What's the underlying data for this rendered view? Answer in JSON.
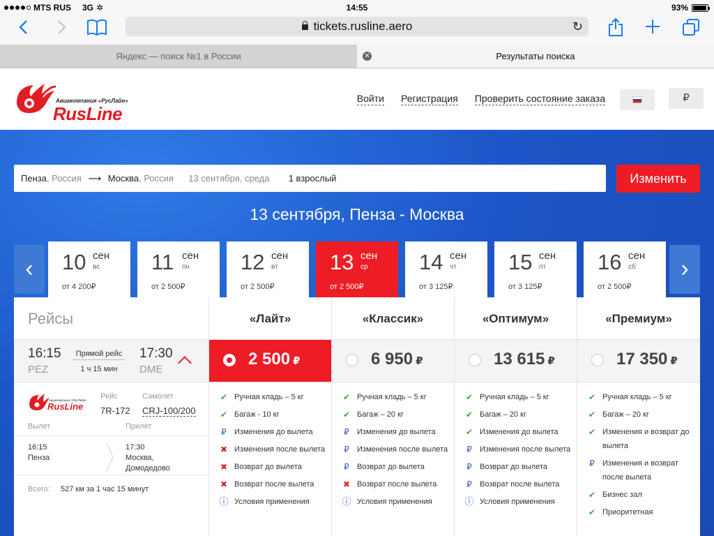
{
  "status": {
    "carrier": "MTS RUS",
    "network": "3G",
    "time": "14:55",
    "battery_text": "93%",
    "battery_level": 0.93
  },
  "browser": {
    "url": "tickets.rusline.aero",
    "tabs": [
      {
        "label": "Яндекс — поиск №1 в России",
        "active": false
      },
      {
        "label": "Результаты поиска",
        "active": true
      }
    ]
  },
  "header": {
    "logo_tagline": "Авиакомпания «РусЛайн»",
    "logo_wordmark": "RusLine",
    "nav": [
      "Войти",
      "Регистрация",
      "Проверить состояние заказа"
    ],
    "currency": "₽",
    "flag_colors": [
      "#ffffff",
      "#1c3fa8",
      "#d52b1e"
    ]
  },
  "search": {
    "from_city": "Пенза",
    "from_country": ", Россия",
    "arrow": "⟶",
    "to_city": "Москва",
    "to_country": ", Россия",
    "date": "13 сентября, среда",
    "passengers": "1 взрослый",
    "change_label": "Изменить"
  },
  "route_title": "13 сентября, Пенза  -  Москва",
  "dates": [
    {
      "day": "10",
      "mon": "сен",
      "wd": "вс",
      "price": "от 4 200₽",
      "selected": false
    },
    {
      "day": "11",
      "mon": "сен",
      "wd": "пн",
      "price": "от 2 500₽",
      "selected": false
    },
    {
      "day": "12",
      "mon": "сен",
      "wd": "вт",
      "price": "от 2 500₽",
      "selected": false
    },
    {
      "day": "13",
      "mon": "сен",
      "wd": "ср",
      "price": "от 2 500₽",
      "selected": true
    },
    {
      "day": "14",
      "mon": "сен",
      "wd": "чт",
      "price": "от 3 125₽",
      "selected": false
    },
    {
      "day": "15",
      "mon": "сен",
      "wd": "пт",
      "price": "от 3 125₽",
      "selected": false
    },
    {
      "day": "16",
      "mon": "сен",
      "wd": "сб",
      "price": "от 2 500₽",
      "selected": false
    }
  ],
  "flights_header": "Рейсы",
  "flight": {
    "dep_time": "16:15",
    "dep_code": "PEZ",
    "direct": "Прямой рейс",
    "duration": "1 ч 15 мин",
    "arr_time": "17:30",
    "arr_code": "DME",
    "flight_label": "Рейс",
    "flight_no": "7R-172",
    "plane_label": "Самолет",
    "plane": "CRJ-100/200",
    "dep_label": "Вылет",
    "arr_label": "Прилет",
    "dep_detail_time": "16:15",
    "dep_detail_city": "Пенза",
    "arr_detail_time": "17:30",
    "arr_detail_city": "Москва,",
    "arr_detail_airport": "Домодедово",
    "total_label": "Всего:",
    "total": "527 км за 1 час 15 минут"
  },
  "fares": [
    {
      "name": "«Лайт»",
      "price": "2 500",
      "cur": "₽",
      "selected": true,
      "features": [
        {
          "icon": "ok",
          "text": "Ручная кладь – 5 кг"
        },
        {
          "icon": "ok",
          "text": "Багаж - 10 кг"
        },
        {
          "icon": "rub",
          "text": "Изменения до вылета"
        },
        {
          "icon": "no",
          "text": "Изменения после вылета"
        },
        {
          "icon": "no",
          "text": "Возврат до вылета"
        },
        {
          "icon": "no",
          "text": "Возврат после вылета"
        },
        {
          "icon": "info",
          "text": "Условия применения"
        }
      ]
    },
    {
      "name": "«Классик»",
      "price": "6 950",
      "cur": "₽",
      "selected": false,
      "features": [
        {
          "icon": "ok",
          "text": "Ручная кладь – 5 кг"
        },
        {
          "icon": "ok",
          "text": "Багаж – 20 кг"
        },
        {
          "icon": "rub",
          "text": "Изменения до вылета"
        },
        {
          "icon": "rub",
          "text": "Изменения после вылета"
        },
        {
          "icon": "rub",
          "text": "Возврат до вылета"
        },
        {
          "icon": "no",
          "text": "Возврат после вылета"
        },
        {
          "icon": "info",
          "text": "Условия применения"
        }
      ]
    },
    {
      "name": "«Оптимум»",
      "price": "13 615",
      "cur": "₽",
      "selected": false,
      "features": [
        {
          "icon": "ok",
          "text": "Ручная кладь – 5 кг"
        },
        {
          "icon": "ok",
          "text": "Багаж – 20 кг"
        },
        {
          "icon": "ok",
          "text": "Изменения до вылета"
        },
        {
          "icon": "rub",
          "text": "Изменения после вылета"
        },
        {
          "icon": "rub",
          "text": "Возврат до вылета"
        },
        {
          "icon": "rub",
          "text": "Возврат после вылета"
        },
        {
          "icon": "info",
          "text": "Условия применения"
        }
      ]
    },
    {
      "name": "«Премиум»",
      "price": "17 350",
      "cur": "₽",
      "selected": false,
      "features": [
        {
          "icon": "ok",
          "text": "Ручная кладь – 5 кг"
        },
        {
          "icon": "ok",
          "text": "Багаж – 20 кг"
        },
        {
          "icon": "ok",
          "text": "Изменения и возврат до вылета"
        },
        {
          "icon": "rub",
          "text": "Изменения и возврат после вылета"
        },
        {
          "icon": "ok",
          "text": "Бизнес зал"
        },
        {
          "icon": "ok",
          "text": "Приоритетная"
        }
      ]
    }
  ],
  "colors": {
    "brand_red": "#ee1c25",
    "ok": "#3bab3b",
    "no": "#e02525",
    "rub": "#3a59c7"
  }
}
